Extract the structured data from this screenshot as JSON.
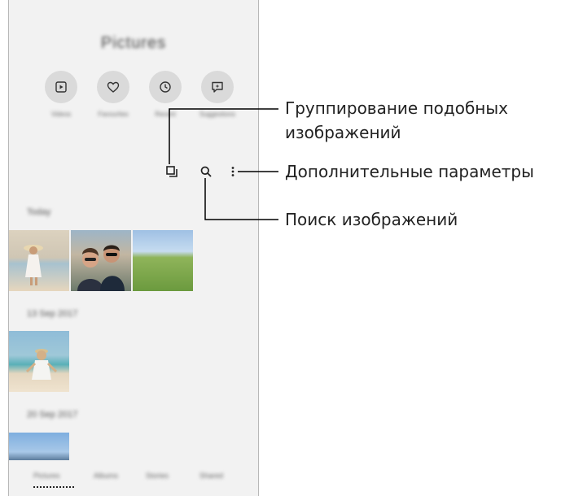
{
  "app": {
    "title": "Pictures"
  },
  "quick_actions": [
    {
      "label": "Videos",
      "icon": "play-icon"
    },
    {
      "label": "Favourites",
      "icon": "heart-icon"
    },
    {
      "label": "Recent",
      "icon": "clock-icon"
    },
    {
      "label": "Suggestions",
      "icon": "sparkle-chat-icon"
    }
  ],
  "toolbar": {
    "group_icon": "group-similar-icon",
    "search_icon": "search-icon",
    "more_icon": "more-vertical-icon"
  },
  "sections": [
    {
      "label": "Today"
    },
    {
      "label": "13 Sep 2017"
    },
    {
      "label": "20 Sep 2017"
    }
  ],
  "bottom_tabs": [
    "Pictures",
    "Albums",
    "Stories",
    "Shared"
  ],
  "callouts": {
    "group_line1": "Группирование подобных",
    "group_line2": "изображений",
    "more": "Дополнительные параметры",
    "search": "Поиск изображений"
  },
  "colors": {
    "phone_bg": "#f2f2f2",
    "line": "#000000",
    "frame": "#b8b8b8"
  }
}
